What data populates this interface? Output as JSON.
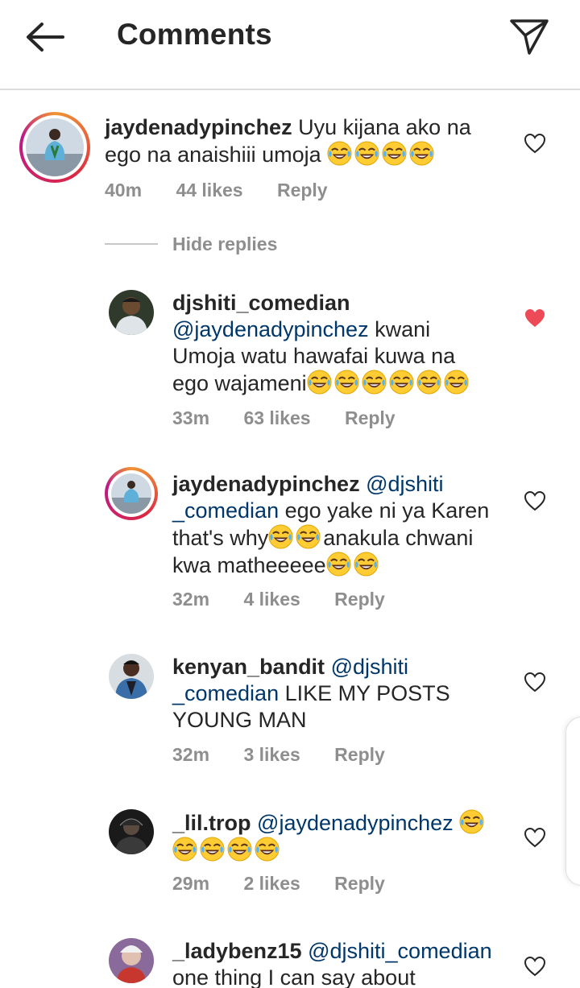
{
  "header": {
    "title": "Comments",
    "back_icon": "arrow-left-icon",
    "send_icon": "send-icon"
  },
  "colors": {
    "text": "#262626",
    "mention": "#00376b",
    "meta": "#8e8e8e",
    "heart_liked": "#ed4956",
    "divider": "#dbdbdb"
  },
  "top_comment": {
    "username": "jaydenadypinchez",
    "line1": "Uyu kijana ako na",
    "line2": "ego na anaishiii umoja",
    "emoji_count": 4,
    "time": "40m",
    "likes": "44 likes",
    "reply": "Reply",
    "liked": false
  },
  "hide_replies": "Hide replies",
  "replies": [
    {
      "username": "djshiti_comedian",
      "mention": "@jaydenadypinchez",
      "line1_rest": " kwani",
      "line2": "Umoja watu hawafai kuwa na",
      "line3": "ego wajameni",
      "time": "33m",
      "likes": "63 likes",
      "reply": "Reply",
      "liked": true
    },
    {
      "username": "jaydenadypinchez",
      "mention_a": "@djshiti",
      "mention_b": "_comedian",
      "line2_rest": " ego yake ni ya Karen",
      "line3_a": "that's why",
      "line3_b": "anakula chwani",
      "line4": "kwa matheeeee",
      "time": "32m",
      "likes": "4 likes",
      "reply": "Reply",
      "liked": false
    },
    {
      "username": "kenyan_bandit",
      "mention_a": "@djshiti",
      "mention_b": "_comedian",
      "line2_rest": " LIKE MY POSTS",
      "line3": "YOUNG MAN",
      "time": "32m",
      "likes": "3 likes",
      "reply": "Reply",
      "liked": false
    },
    {
      "username": "_lil.trop",
      "mention": "@jaydenadypinchez",
      "time": "29m",
      "likes": "2 likes",
      "reply": "Reply",
      "liked": false
    },
    {
      "username": "_ladybenz15",
      "mention": "@djshiti_comedian",
      "line2": "one thing I can say about",
      "liked": false
    }
  ]
}
